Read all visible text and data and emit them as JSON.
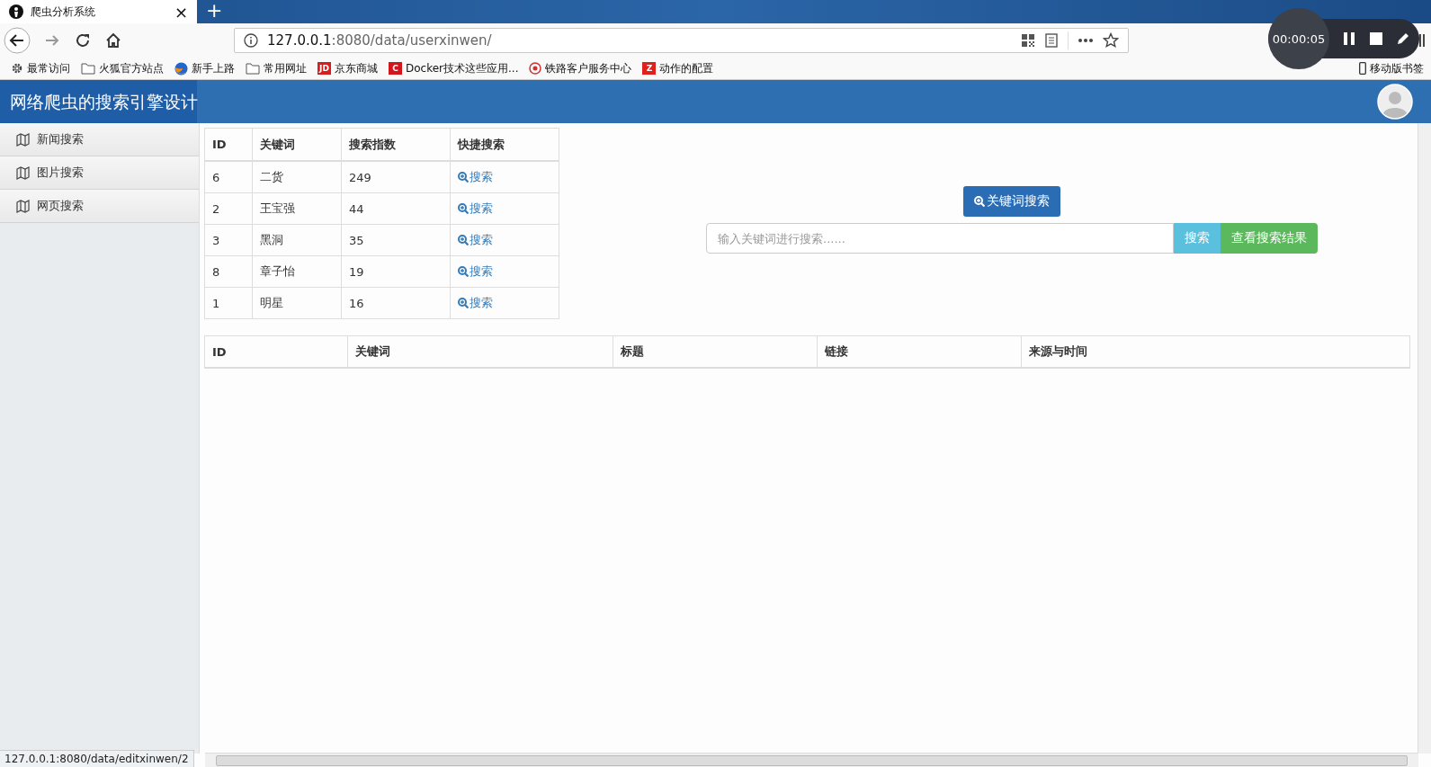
{
  "browser": {
    "tab": {
      "title": "爬虫分析系统",
      "close": "×"
    },
    "new_tab": "+",
    "address": {
      "host": "127.0.0.1",
      "path": ":8080/data/userxinwen/"
    },
    "bookmarks": [
      {
        "kind": "gear",
        "label": "最常访问"
      },
      {
        "kind": "folder",
        "label": "火狐官方站点"
      },
      {
        "kind": "globe",
        "label": "新手上路"
      },
      {
        "kind": "folder",
        "label": "常用网址"
      },
      {
        "kind": "letter",
        "badge": "JD",
        "color": "#d71d1d",
        "label": "京东商城"
      },
      {
        "kind": "letter",
        "badge": "C",
        "color": "#d4161c",
        "label": "Docker技术这些应用..."
      },
      {
        "kind": "target",
        "label": "铁路客户服务中心"
      },
      {
        "kind": "letter",
        "badge": "Z",
        "color": "#e0201b",
        "label": "动作的配置"
      }
    ],
    "mobile_bookmarks": "移动版书签"
  },
  "recorder": {
    "time": "00:00:05"
  },
  "app": {
    "title": "网络爬虫的搜索引擎设计"
  },
  "sidebar": {
    "items": [
      {
        "label": "新闻搜索"
      },
      {
        "label": "图片搜索"
      },
      {
        "label": "网页搜索"
      }
    ]
  },
  "keyword_table": {
    "columns": [
      "ID",
      "关键词",
      "搜索指数",
      "快捷搜索"
    ],
    "rows": [
      {
        "id": "6",
        "keyword": "二货",
        "index": "249",
        "action": "搜索"
      },
      {
        "id": "2",
        "keyword": "王宝强",
        "index": "44",
        "action": "搜索"
      },
      {
        "id": "3",
        "keyword": "黑洞",
        "index": "35",
        "action": "搜索"
      },
      {
        "id": "8",
        "keyword": "章子怡",
        "index": "19",
        "action": "搜索"
      },
      {
        "id": "1",
        "keyword": "明星",
        "index": "16",
        "action": "搜索"
      }
    ]
  },
  "keyword_search_button": "关键词搜索",
  "search": {
    "placeholder": "输入关键词进行搜索......",
    "search_button": "搜索",
    "results_button": "查看搜索结果"
  },
  "results_table": {
    "columns": [
      "ID",
      "关键词",
      "标题",
      "链接",
      "来源与时间"
    ]
  },
  "status_bar": "127.0.0.1:8080/data/editxinwen/2"
}
